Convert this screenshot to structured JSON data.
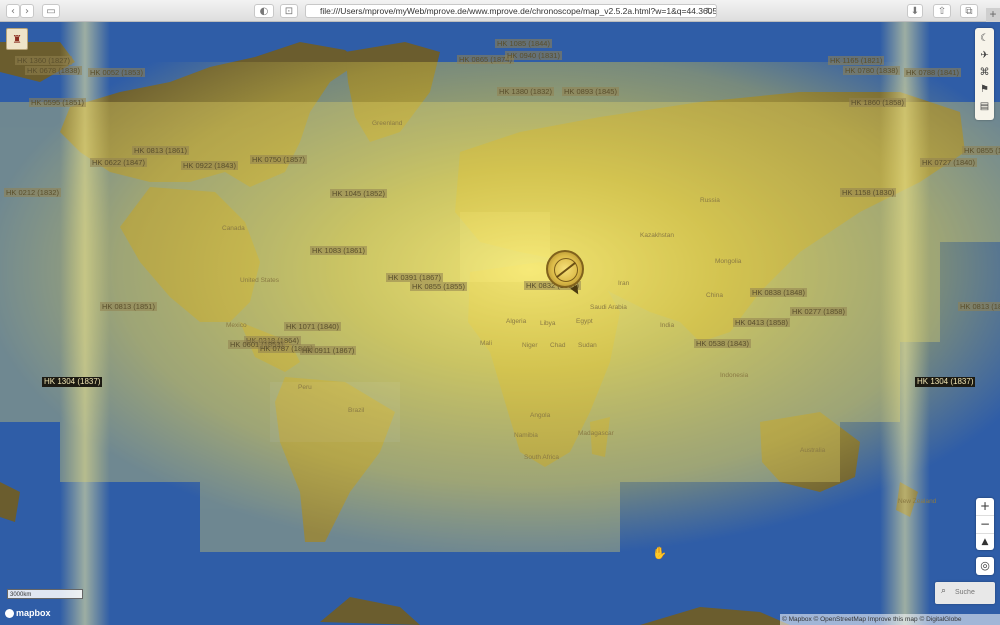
{
  "browser": {
    "url": "file:///Users/mprove/myWeb/mprove.de/www.mprove.de/chronoscope/map_v2.5.2a.html?w=1&q=44.36050,34.2"
  },
  "map": {
    "hk_labels": [
      {
        "text": "HK 1085 (1844)",
        "dark": false
      },
      {
        "text": "HK 0865 (1874)",
        "dark": false
      },
      {
        "text": "HK 0940 (1831)",
        "dark": false
      },
      {
        "text": "HK 1360 (1827)",
        "dark": false
      },
      {
        "text": "HK 0678 (1838)",
        "dark": false
      },
      {
        "text": "HK 0052 (1853)",
        "dark": false
      },
      {
        "text": "HK 1380 (1832)",
        "dark": false
      },
      {
        "text": "HK 0893 (1845)",
        "dark": false
      },
      {
        "text": "HK 0595 (1851)",
        "dark": false
      },
      {
        "text": "HK 1165 (1821)",
        "dark": false
      },
      {
        "text": "HK 0780 (1838)",
        "dark": false
      },
      {
        "text": "HK 0788 (1841)",
        "dark": false
      },
      {
        "text": "HK 1860 (1858)",
        "dark": false
      },
      {
        "text": "HK 0813 (1861)",
        "dark": false
      },
      {
        "text": "HK 0622 (1847)",
        "dark": false
      },
      {
        "text": "HK 0750 (1857)",
        "dark": false
      },
      {
        "text": "HK 0922 (1843)",
        "dark": false
      },
      {
        "text": "HK 0212 (1832)",
        "dark": false
      },
      {
        "text": "HK 0727 (1840)",
        "dark": false
      },
      {
        "text": "HK 1045 (1852)",
        "dark": false
      },
      {
        "text": "HK 0855 (1854)",
        "dark": false
      },
      {
        "text": "HK 1158 (1830)",
        "dark": false
      },
      {
        "text": "HK 1083 (1861)",
        "dark": false
      },
      {
        "text": "HK 0391 (1867)",
        "dark": false
      },
      {
        "text": "HK 0855 (1855)",
        "dark": false
      },
      {
        "text": "HK 0832 (1857)",
        "dark": false
      },
      {
        "text": "HK 0838 (1848)",
        "dark": false
      },
      {
        "text": "HK 0813 (1851)",
        "dark": false
      },
      {
        "text": "HK 0813 (1851)",
        "dark": false
      },
      {
        "text": "HK 0277 (1858)",
        "dark": false
      },
      {
        "text": "HK 0413 (1858)",
        "dark": false
      },
      {
        "text": "HK 1071 (1840)",
        "dark": false
      },
      {
        "text": "HK 0318 (1864)",
        "dark": false
      },
      {
        "text": "HK 0601 (1853)",
        "dark": false
      },
      {
        "text": "HK 0787 (1845)",
        "dark": false
      },
      {
        "text": "HK 0911 (1867)",
        "dark": false
      },
      {
        "text": "HK 0538 (1843)",
        "dark": false
      },
      {
        "text": "HK 1304 (1837)",
        "dark": true
      },
      {
        "text": "HK 1304 (1837)",
        "dark": true
      }
    ],
    "place_labels": [
      "Greenland",
      "Canada",
      "United States",
      "Mexico",
      "Brazil",
      "Peru",
      "Russia",
      "Mongolia",
      "China",
      "India",
      "Mali",
      "Algeria",
      "Libya",
      "Egypt",
      "Niger",
      "Chad",
      "Sudan",
      "Angola",
      "Namibia",
      "South Africa",
      "Madagascar",
      "Indonesia",
      "Australia",
      "New Zealand",
      "Kazakhstan",
      "Iran",
      "Saudi Arabia"
    ],
    "scale_label": "3000km",
    "brand": "mapbox",
    "attribution": "© Mapbox  © OpenStreetMap  Improve this map  © DigitalGlobe",
    "search_placeholder": "Suche"
  },
  "colors": {
    "ocean": "#2f5da7",
    "land": "#6b5d2e",
    "heat": "#e9d84a"
  }
}
